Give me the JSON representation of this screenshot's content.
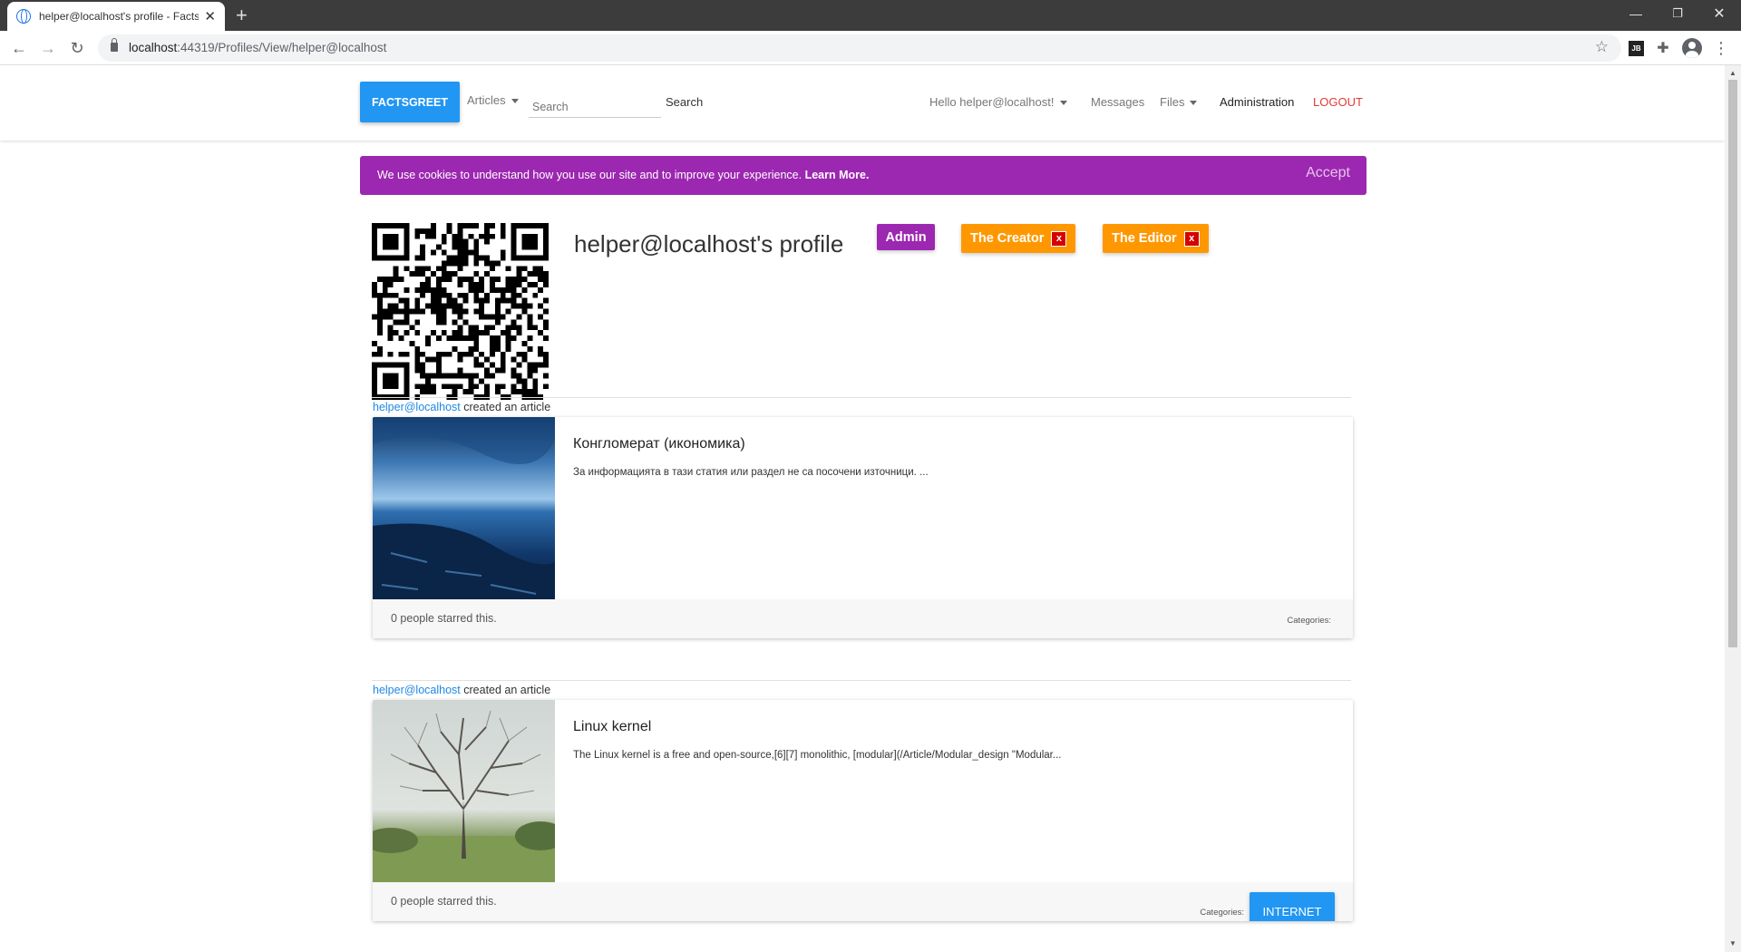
{
  "browser": {
    "tab_title": "helper@localhost's profile - FactsGreet",
    "url_host": "localhost",
    "url_path": ":44319/Profiles/View/helper@localhost",
    "extension_label": "JB"
  },
  "navbar": {
    "brand": "FACTSGREET",
    "articles": "Articles",
    "search_placeholder": "Search",
    "search_button": "Search",
    "greeting": "Hello helper@localhost!",
    "messages": "Messages",
    "files": "Files",
    "administration": "Administration",
    "logout": "LOGOUT"
  },
  "cookie": {
    "message": "We use cookies to understand how you use our site and to improve your experience.",
    "learn_more": "Learn More.",
    "accept": "Accept"
  },
  "profile": {
    "title": "helper@localhost's profile",
    "badges": [
      {
        "label": "Admin",
        "color": "#9c27b0",
        "removable": false
      },
      {
        "label": "The Creator",
        "color": "#ff9800",
        "removable": true,
        "remove_label": "x"
      },
      {
        "label": "The Editor",
        "color": "#ff9800",
        "removable": true,
        "remove_label": "x"
      }
    ]
  },
  "activities": [
    {
      "user": "helper@localhost",
      "action": " created an article",
      "article": {
        "title": "Конгломерат (икономика)",
        "excerpt": "За информацията в тази статия или раздел не са посочени източници. ...",
        "stars": "0 people starred this.",
        "categories_label": "Categories:",
        "categories": [],
        "image": "blue-night-seascape"
      }
    },
    {
      "user": "helper@localhost",
      "action": " created an article",
      "article": {
        "title": "Linux kernel",
        "excerpt": "The Linux kernel is a free and open-source,[6][7] monolithic, [modular](/Article/Modular_design \"Modular...",
        "stars": "0 people starred this.",
        "categories_label": "Categories:",
        "categories": [
          "INTERNET"
        ],
        "image": "bare-tree-park"
      }
    }
  ],
  "colors": {
    "brand": "#2196f3",
    "cookie_bg": "#9c27b0",
    "badge_orange": "#ff9800",
    "logout": "#e53935",
    "link": "#1e88e5"
  }
}
